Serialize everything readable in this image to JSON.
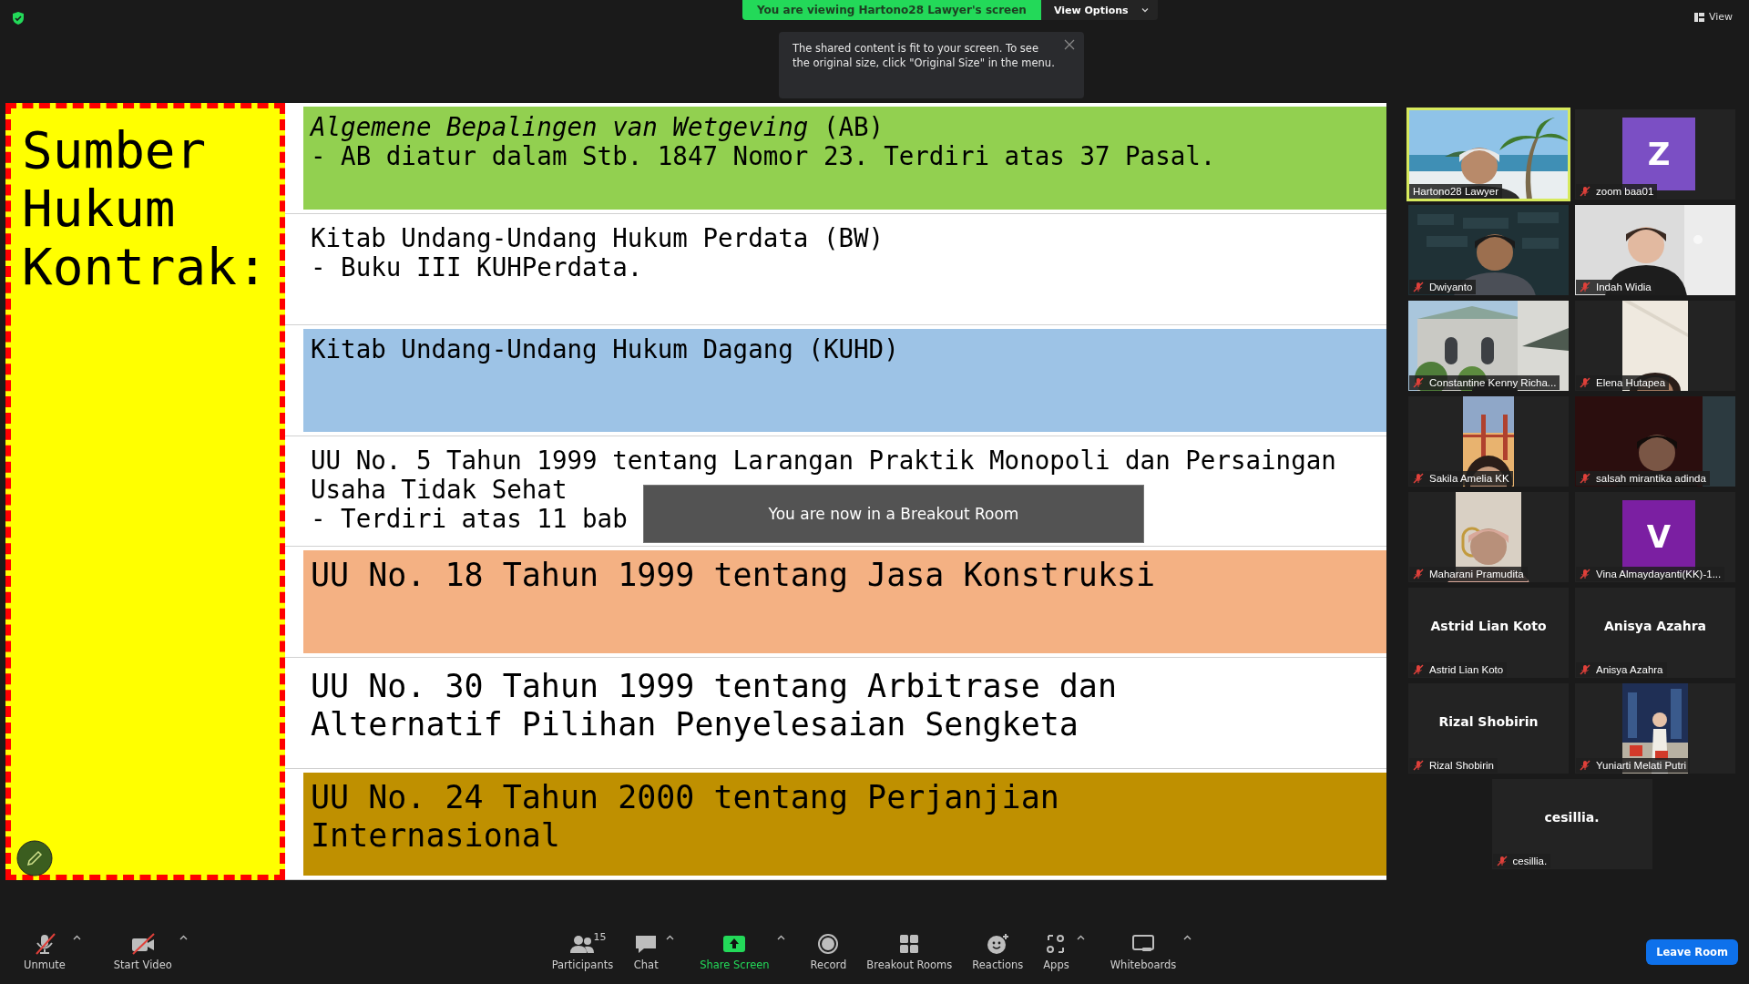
{
  "top_bar": {
    "sharing_banner": "You are viewing Hartono28 Lawyer's screen",
    "view_options": "View Options",
    "view_button": "View"
  },
  "tooltip": {
    "text": "The shared content is fit to your screen. To see the original size, click \"Original Size\" in the menu."
  },
  "slide": {
    "heading": "Sumber Hukum Kontrak:",
    "rows": [
      {
        "color": "#92d050",
        "kind": "normal",
        "lines": [
          "*Algemene Bepalingen van Wetgeving* (AB)",
          "- AB diatur dalam Stb. 1847 Nomor 23. Terdiri atas 37 Pasal."
        ]
      },
      {
        "color": "#ffffff",
        "kind": "normal",
        "lines": [
          "Kitab Undang-Undang Hukum Perdata (BW)",
          "- Buku III KUHPerdata."
        ]
      },
      {
        "color": "#9dc3e6",
        "kind": "normal",
        "lines": [
          "Kitab Undang-Undang Hukum Dagang (KUHD)"
        ]
      },
      {
        "color": "#ffffff",
        "kind": "normal",
        "lines": [
          "UU No. 5 Tahun 1999 tentang Larangan Praktik Monopoli dan Persaingan Usaha Tidak Sehat",
          "- Terdiri atas 11 bab"
        ]
      },
      {
        "color": "#f4b183",
        "kind": "large",
        "lines": [
          "UU No. 18 Tahun 1999 tentang Jasa Konstruksi"
        ]
      },
      {
        "color": "#ffffff",
        "kind": "large",
        "lines": [
          "UU No. 30 Tahun 1999 tentang Arbitrase dan",
          "Alternatif Pilihan Penyelesaian Sengketa"
        ]
      },
      {
        "color": "#bf9000",
        "kind": "large",
        "lines": [
          "UU No. 24 Tahun 2000 tentang Perjanjian",
          "Internasional"
        ]
      }
    ]
  },
  "toast": {
    "text": "You are now in a Breakout Room"
  },
  "gallery": [
    {
      "name": "Hartono28 Lawyer",
      "kind": "video",
      "muted": false,
      "speaking": true
    },
    {
      "name": "zoom baa01",
      "kind": "avatar",
      "avatar_letter": "Z",
      "color": "#7b4fc4",
      "muted": true,
      "speaking": false
    },
    {
      "name": "Dwiyanto",
      "kind": "video",
      "muted": true,
      "speaking": false
    },
    {
      "name": "Indah Widia",
      "kind": "video",
      "muted": true,
      "speaking": false
    },
    {
      "name": "Constantine Kenny Richa...",
      "kind": "video",
      "muted": true,
      "speaking": false
    },
    {
      "name": "Elena Hutapea",
      "kind": "video",
      "muted": true,
      "speaking": false
    },
    {
      "name": "Sakila Amelia KK",
      "kind": "video",
      "muted": true,
      "speaking": false
    },
    {
      "name": "salsah mirantika adinda",
      "kind": "video",
      "muted": true,
      "speaking": false
    },
    {
      "name": "Maharani Pramudita",
      "kind": "video",
      "muted": true,
      "speaking": false
    },
    {
      "name": "Vina Almaydayanti(KK)-1...",
      "kind": "avatar",
      "avatar_letter": "V",
      "color": "#7b1fa2",
      "muted": true,
      "speaking": false
    },
    {
      "name": "Astrid Lian Koto",
      "kind": "name",
      "display_name": "Astrid Lian Koto",
      "muted": true,
      "speaking": false
    },
    {
      "name": "Anisya Azahra",
      "kind": "name",
      "display_name": "Anisya Azahra",
      "muted": true,
      "speaking": false
    },
    {
      "name": "Rizal Shobirin",
      "kind": "name",
      "display_name": "Rizal Shobirin",
      "muted": true,
      "speaking": false
    },
    {
      "name": "Yuniarti Melati Putri",
      "kind": "video",
      "muted": true,
      "speaking": false
    },
    {
      "name": "cesillia.",
      "kind": "name",
      "display_name": "cesillia.",
      "muted": true,
      "speaking": false
    }
  ],
  "toolbar": {
    "left": [
      {
        "label": "Unmute",
        "kind": "mic-off",
        "caret": true
      },
      {
        "label": "Start Video",
        "kind": "video-off",
        "caret": true
      }
    ],
    "center": [
      {
        "label": "Participants",
        "kind": "people",
        "count": "15",
        "caret": false
      },
      {
        "label": "Chat",
        "kind": "chat",
        "caret": true
      },
      {
        "label": "Share Screen",
        "kind": "share",
        "caret": true
      },
      {
        "label": "Record",
        "kind": "record",
        "caret": false
      },
      {
        "label": "Breakout Rooms",
        "kind": "grid",
        "caret": false
      },
      {
        "label": "Reactions",
        "kind": "smile",
        "caret": false
      },
      {
        "label": "Apps",
        "kind": "apps",
        "caret": true
      },
      {
        "label": "Whiteboards",
        "kind": "board",
        "caret": true
      }
    ],
    "leave": "Leave Room"
  }
}
